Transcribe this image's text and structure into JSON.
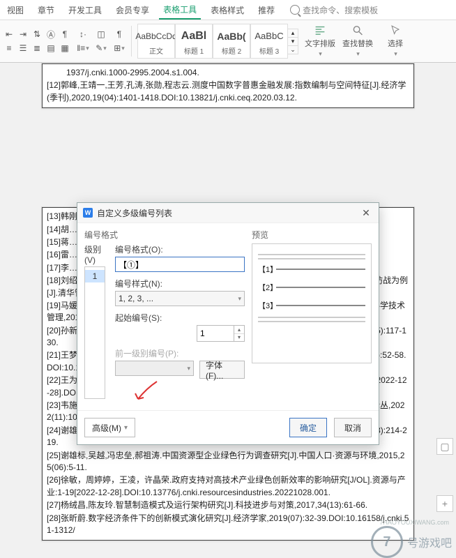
{
  "tabs": {
    "view": "视图",
    "chapter": "章节",
    "devtools": "开发工具",
    "member": "会员专享",
    "table_tools": "表格工具",
    "table_style": "表格样式",
    "recommend": "推荐"
  },
  "search": {
    "placeholder": "查找命令、搜索模板"
  },
  "styles": {
    "s1": {
      "sample": "AaBbCcDd",
      "name": "正文"
    },
    "s2": {
      "sample": "AaBl",
      "name": "标题 1"
    },
    "s3": {
      "sample": "AaBb(",
      "name": "标题 2"
    },
    "s4": {
      "sample": "AaBbC",
      "name": "标题 3"
    }
  },
  "tools": {
    "layout": "文字排版",
    "findrep": "查找替换",
    "select": "选择"
  },
  "refs_top": [
    "1937/j.cnki.1000-2995.2004.s1.004.",
    "[12]郭峰,王靖一,王芳,孔涛,张勋,程志云.测度中国数字普惠金融发展:指数编制与空间特征[J].经济学(季刊),2020,19(04):1401-1418.DOI:10.13821/j.cnki.ceq.2020.03.12."
  ],
  "refs_mid": [
    "[13]韩刚……源革命[J].管理……",
    "[14]胡……dqc.2022.000……",
    "[15]蒋……当代经济管理……",
    "[16]雷……管理案例研……",
    "[17]李……7(02):143-14……"
  ],
  "refs_bot": [
    "[18]刘绍荣,夏宁敏.产业赋能平台:智能时代的商业模式变革——以贝壳与 58 同城的平台攻防战为例[J].清华管理评论,2019(Z1):124-134.",
    "[19]马媛,侯贵生,尹华.企业绿色创新驱动因素研究——基于资源型企业的实证[J].科学学与科学技术管理,2016,37(04):98-105.",
    "[20]孙新波,苏钟海.数据赋能驱动制造业企业实现敏捷制造案例研究[J].管理科学,2018,31(05):117-130.",
    "[21]王梦菲,张昕蔚.数字经济时代技术变革对生产过程的影响机制研究[J].经济学家,2020(01):52-58.DOI:10.16158/j.cnki.51-1312/f.2020.01.006.",
    "[22]王为东，沈悦，王笑楠,卢娜.女性高管权力与企业绿色创新[J/OL].华东经济管理：1-11[2022-12-28].DOI:10.19629/j.cnki.34-1014/f.220319005.",
    "[23]韦施威,杜金岷,潘爽.数字经济如何促进绿色创新——来自中国城市的经验证据[J].财经论丛,2022(11):10-20.DOI:10.13762/j.cnki.cjlc.20220308.001.",
    "[24]谢雄标,孙静怡.中小制造企业绿色创新障碍因素的实证研究[J].科技管理研究,2021,41(18):214-219.",
    "[25]谢雄标,吴越,冯忠垒,郝祖涛.中国资源型企业绿色行为调查研究[J].中国人口·资源与环境,2015,25(06):5-11.",
    "[26]徐敏，周婷婷，王凌，许晶荣.政府支持对高技术产业绿色创新效率的影响研究[J/OL].资源与产业:1-19[2022-12-28].DOI:10.13776/j.cnki.resourcesindustries.20221028.001.",
    "[27]杨绒昌,陈友玲.智慧制造模式及运行架构研究[J].科技进步与对策,2017,34(13):61-66.",
    "[28]张昕蔚.数字经济条件下的创新模式演化研究[J].经济学家,2019(07):32-39.DOI:10.16158/j.cnki.51-1312/"
  ],
  "dialog": {
    "title": "自定义多级编号列表",
    "sec_format": "编号格式",
    "sec_preview": "预览",
    "level_label": "级别(V)",
    "level_value": "1",
    "fmt_label": "编号格式(O):",
    "fmt_value": "【①】",
    "style_label": "编号样式(N):",
    "style_value": "1, 2, 3, ...",
    "start_label": "起始编号(S):",
    "start_value": "1",
    "prev_label": "前一级别编号(P):",
    "font_btn": "字体(F)...",
    "adv_btn": "高级(M)",
    "ok": "确定",
    "cancel": "取消",
    "pv": [
      "【1】",
      "【2】",
      "【3】"
    ]
  }
}
